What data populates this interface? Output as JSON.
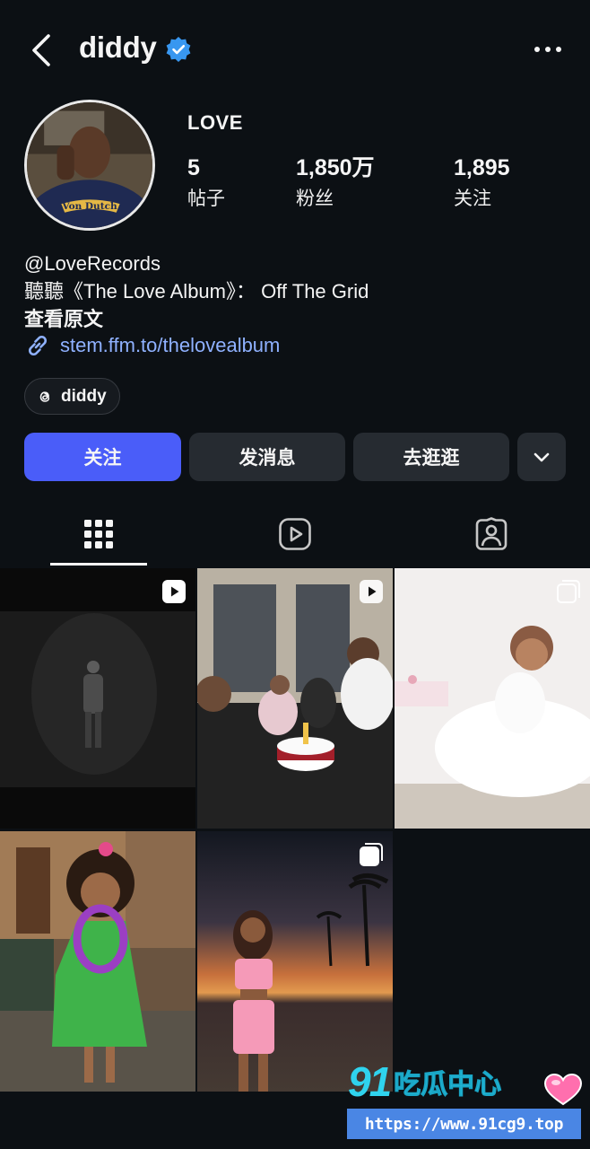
{
  "header": {
    "username": "diddy",
    "back_icon": "chevron-left-icon",
    "verified_icon": "verified-badge-icon",
    "more_icon": "more-horizontal-icon"
  },
  "profile": {
    "display_name": "LOVE",
    "stats": {
      "posts": {
        "value": "5",
        "label": "帖子"
      },
      "followers": {
        "value": "1,850万",
        "label": "粉丝"
      },
      "following": {
        "value": "1,895",
        "label": "关注"
      }
    },
    "bio": {
      "line1": "@LoveRecords",
      "line2": " 聽聽《The Love Album》： Off The Grid",
      "see_original": "查看原文"
    },
    "link": "stem.ffm.to/thelovealbum",
    "threads_chip": "diddy"
  },
  "actions": {
    "follow": "关注",
    "message": "发消息",
    "visit": "去逛逛"
  },
  "tabs": [
    "grid-icon",
    "reels-icon",
    "tagged-icon"
  ],
  "watermark": {
    "logo_number": "91",
    "logo_text": "吃瓜中心",
    "url": "https://www.91cg9.top"
  },
  "colors": {
    "background": "#0c1014",
    "follow_button": "#4a5df9",
    "secondary_button": "#262b31",
    "link": "#8fb1ff",
    "verified": "#3897f0"
  }
}
